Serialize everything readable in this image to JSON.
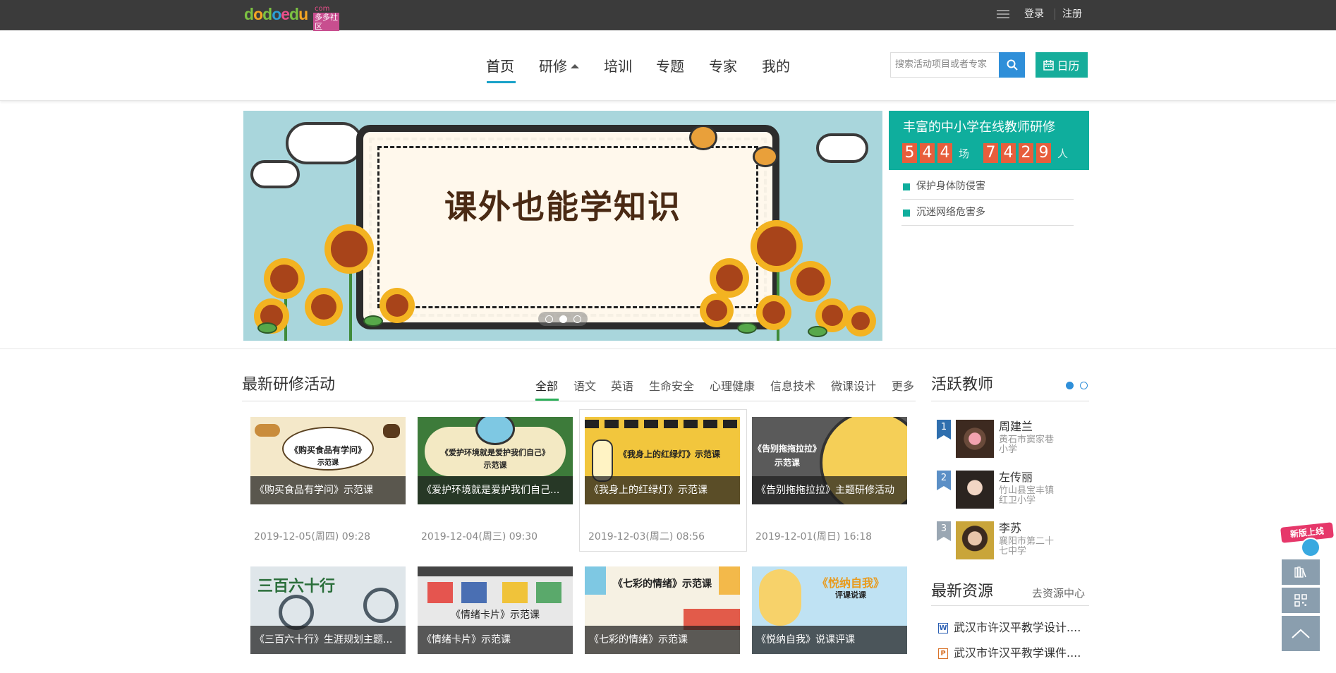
{
  "topbar": {
    "logo_main": "dodoedu",
    "logo_sub": "com",
    "logo_tag": "多多社区",
    "login": "登录",
    "register": "注册"
  },
  "nav": {
    "items": [
      "首页",
      "研修",
      "培训",
      "专题",
      "专家",
      "我的"
    ],
    "active": "首页",
    "search_placeholder": "搜索活动项目或者专家",
    "calendar_label": "日历"
  },
  "banner": {
    "text": "课外也能学知识",
    "slides": 3,
    "active_slide": 2
  },
  "stats": {
    "title": "丰富的中小学在线教师研修",
    "sessions_digits": [
      "5",
      "4",
      "4"
    ],
    "sessions_unit": "场",
    "people_digits": [
      "7",
      "4",
      "2",
      "9"
    ],
    "people_unit": "人",
    "news": [
      "保护身体防侵害",
      "沉迷网络危害多"
    ]
  },
  "activities": {
    "title": "最新研修活动",
    "tabs": [
      "全部",
      "语文",
      "英语",
      "生命安全",
      "心理健康",
      "信息技术",
      "微课设计",
      "更多"
    ],
    "active_tab": "全部",
    "cards": [
      {
        "caption": "《购买食品有学问》示范课",
        "date": "2019-12-05(周四) 09:28",
        "art": "《购买食品有学问》",
        "art_sub": "示范课"
      },
      {
        "caption": "《爱护环境就是爱护我们自己...",
        "date": "2019-12-04(周三) 09:30",
        "art": "《爱护环境就是爱护我们自己》",
        "art_sub": "示范课"
      },
      {
        "caption": "《我身上的红绿灯》示范课",
        "date": "2019-12-03(周二) 08:56",
        "art": "《我身上的红绿灯》示范课",
        "art_sub": ""
      },
      {
        "caption": "《告别拖拖拉拉》主题研修活动",
        "date": "2019-12-01(周日) 16:18",
        "art": "《告别拖拖拉拉》",
        "art_sub": "示范课"
      },
      {
        "caption": "《三百六十行》生涯规划主题...",
        "date": "",
        "art": "三百六十行",
        "art_sub": ""
      },
      {
        "caption": "《情绪卡片》示范课",
        "date": "",
        "art": "《情绪卡片》示范课",
        "art_sub": ""
      },
      {
        "caption": "《七彩的情绪》示范课",
        "date": "",
        "art": "《七彩的情绪》示范课",
        "art_sub": ""
      },
      {
        "caption": "《悦纳自我》说课评课",
        "date": "",
        "art": "《悦纳自我》",
        "art_sub": "评课说课"
      }
    ]
  },
  "teachers": {
    "title": "活跃教师",
    "list": [
      {
        "rank": "1",
        "name": "周建兰",
        "school": "黄石市窦家巷小学",
        "rank_color": "#2f6fae"
      },
      {
        "rank": "2",
        "name": "左传丽",
        "school": "竹山县宝丰镇红卫小学",
        "rank_color": "#5b8fc6"
      },
      {
        "rank": "3",
        "name": "李苏",
        "school": "襄阳市第二十七中学",
        "rank_color": "#9aa7b3"
      }
    ]
  },
  "resources": {
    "title": "最新资源",
    "more": "去资源中心",
    "items": [
      {
        "type": "W",
        "name": "武汉市许汉平教学设计....",
        "color": "#2b5fb3"
      },
      {
        "type": "P",
        "name": "武汉市许汉平教学课件....",
        "color": "#d9742b"
      }
    ]
  },
  "float": {
    "badge": "新版上线"
  }
}
